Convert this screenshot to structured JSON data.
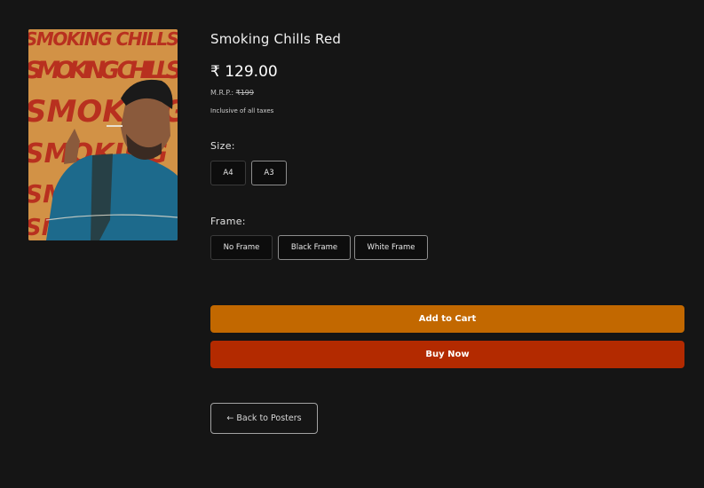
{
  "product": {
    "title": "Smoking Chills Red",
    "price": "₹ 129.00",
    "mrp_label": "M.R.P.:",
    "mrp_value": "₹199",
    "tax_note": "Inclusive of all taxes",
    "poster_text": [
      "SMOKING CHILLS",
      "SMOKING CHILLS",
      "SMOKING",
      "SMOKING",
      "SMOKING",
      "SMOKING"
    ]
  },
  "size": {
    "label": "Size:",
    "options": [
      "A4",
      "A3"
    ],
    "selected": "A3"
  },
  "frame": {
    "label": "Frame:",
    "options": [
      "No Frame",
      "Black Frame",
      "White Frame"
    ],
    "selected": [
      "Black Frame",
      "White Frame"
    ]
  },
  "actions": {
    "add_to_cart": "Add to Cart",
    "buy_now": "Buy Now",
    "back": "← Back to Posters"
  },
  "colors": {
    "background": "#151515",
    "add_to_cart": "#c26800",
    "buy_now": "#b32a00",
    "poster_red": "#c7402f",
    "poster_gold": "#d3a14a"
  }
}
